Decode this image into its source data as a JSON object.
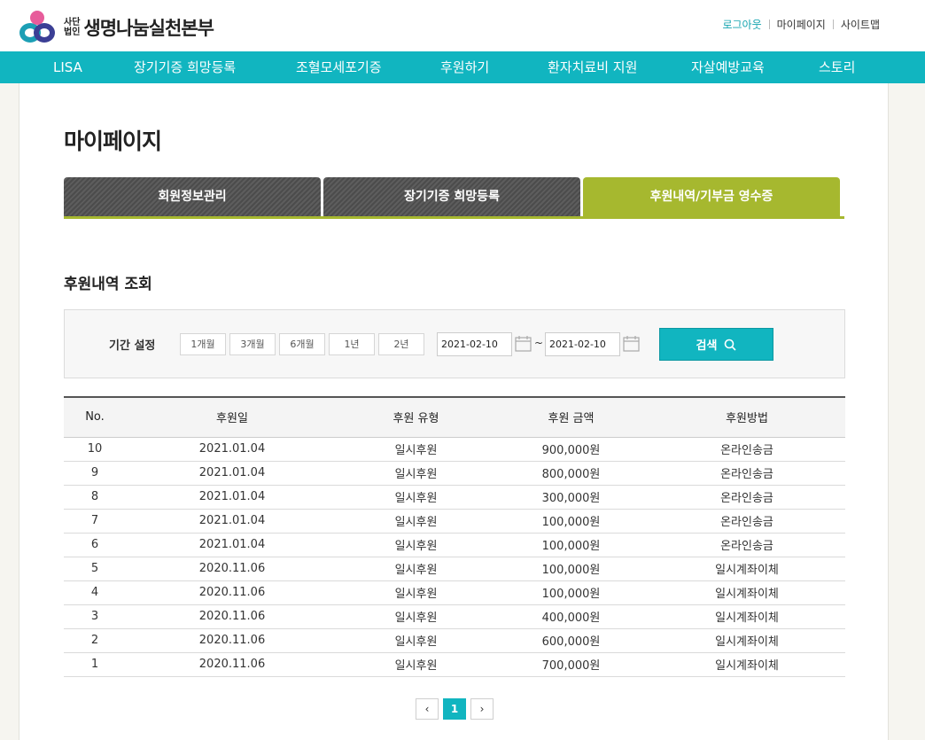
{
  "brand": {
    "sub_top": "사단",
    "sub_bottom": "법인",
    "name": "생명나눔실천본부"
  },
  "utils": {
    "logout": "로그아웃",
    "mypage": "마이페이지",
    "sitemap": "사이트맵"
  },
  "gnb": [
    "LISA",
    "장기기증 희망등록",
    "조혈모세포기증",
    "후원하기",
    "환자치료비 지원",
    "자살예방교육",
    "스토리"
  ],
  "page_title": "마이페이지",
  "tabs": [
    {
      "label": "회원정보관리",
      "active": false
    },
    {
      "label": "장기기증 희망등록",
      "active": false
    },
    {
      "label": "후원내역/기부금 영수증",
      "active": true
    }
  ],
  "section_title": "후원내역 조회",
  "search": {
    "label": "기간 설정",
    "periods": [
      "1개월",
      "3개월",
      "6개월",
      "1년",
      "2년"
    ],
    "date_from": "2021-02-10",
    "date_to": "2021-02-10",
    "tilde": "~",
    "button": "검색"
  },
  "table": {
    "headers": [
      "No.",
      "후원일",
      "후원 유형",
      "후원 금액",
      "후원방법"
    ],
    "rows": [
      [
        "10",
        "2021.01.04",
        "일시후원",
        "900,000원",
        "온라인송금"
      ],
      [
        "9",
        "2021.01.04",
        "일시후원",
        "800,000원",
        "온라인송금"
      ],
      [
        "8",
        "2021.01.04",
        "일시후원",
        "300,000원",
        "온라인송금"
      ],
      [
        "7",
        "2021.01.04",
        "일시후원",
        "100,000원",
        "온라인송금"
      ],
      [
        "6",
        "2021.01.04",
        "일시후원",
        "100,000원",
        "온라인송금"
      ],
      [
        "5",
        "2020.11.06",
        "일시후원",
        "100,000원",
        "일시계좌이체"
      ],
      [
        "4",
        "2020.11.06",
        "일시후원",
        "100,000원",
        "일시계좌이체"
      ],
      [
        "3",
        "2020.11.06",
        "일시후원",
        "400,000원",
        "일시계좌이체"
      ],
      [
        "2",
        "2020.11.06",
        "일시후원",
        "600,000원",
        "일시계좌이체"
      ],
      [
        "1",
        "2020.11.06",
        "일시후원",
        "700,000원",
        "일시계좌이체"
      ]
    ]
  },
  "pager": {
    "prev": "‹",
    "current": "1",
    "next": "›"
  },
  "colors": {
    "accent": "#11b5c0",
    "tab_active": "#a6b82f",
    "tab_inactive": "#555555"
  }
}
